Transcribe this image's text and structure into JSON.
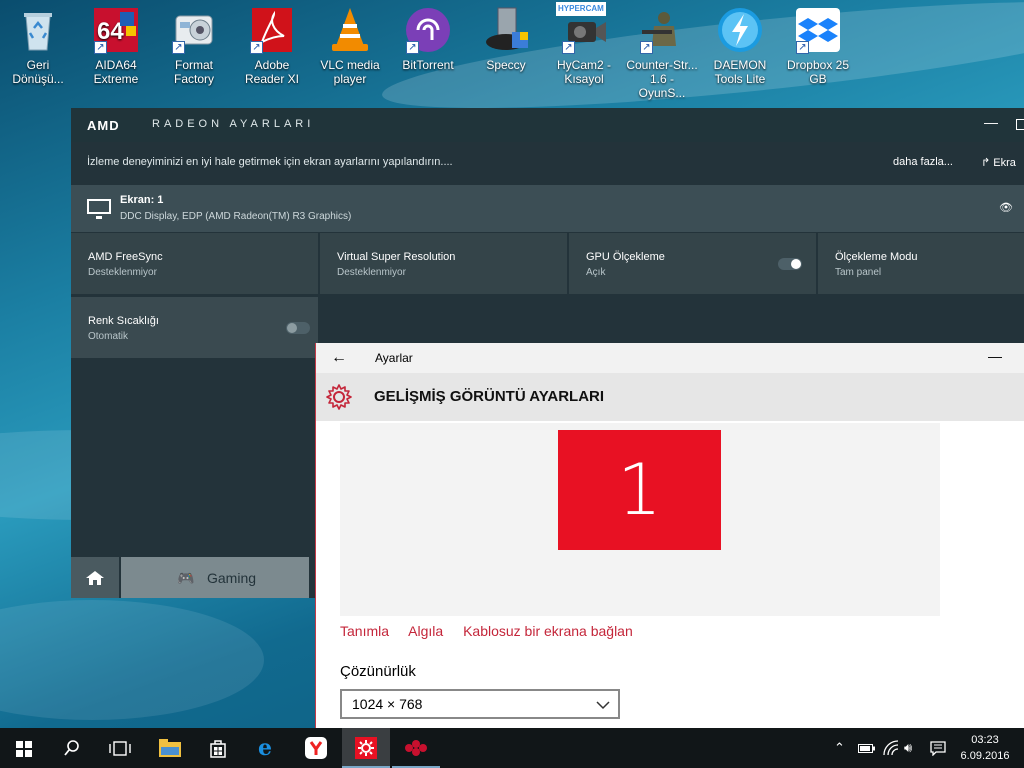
{
  "desktop": {
    "icons": [
      {
        "label": "Geri Dönüşü...",
        "icon": "recycle-bin-icon"
      },
      {
        "label": "AIDA64 Extreme",
        "icon": "aida64-icon"
      },
      {
        "label": "Format Factory",
        "icon": "format-factory-icon"
      },
      {
        "label": "Adobe Reader XI",
        "icon": "adobe-reader-icon"
      },
      {
        "label": "VLC media player",
        "icon": "vlc-icon"
      },
      {
        "label": "BitTorrent",
        "icon": "bittorrent-icon"
      },
      {
        "label": "Speccy",
        "icon": "speccy-icon"
      },
      {
        "label": "HyCam2 - Kısayol",
        "icon": "hycam-icon",
        "badge": "HYPERCAM"
      },
      {
        "label": "Counter-Str... 1.6 - OyunS...",
        "icon": "counter-strike-icon"
      },
      {
        "label": "DAEMON Tools Lite",
        "icon": "daemon-tools-icon"
      },
      {
        "label": "Dropbox 25 GB",
        "icon": "dropbox-icon"
      }
    ],
    "aida_text": "64"
  },
  "amd": {
    "logo": "AMD",
    "title": "RADEON AYARLARI",
    "description": "İzleme deneyiminizi en iyi hale getirmek için ekran ayarlarını yapılandırın....",
    "more_link": "daha fazla...",
    "external_link": "Ekra",
    "display": {
      "name": "Ekran: 1",
      "detail": "DDC Display, EDP (AMD Radeon(TM) R3 Graphics)"
    },
    "tiles": [
      {
        "title": "AMD FreeSync",
        "status": "Desteklenmiyor"
      },
      {
        "title": "Virtual Super Resolution",
        "status": "Desteklenmiyor"
      },
      {
        "title": "GPU Ölçekleme",
        "status": "Açık",
        "toggle": "on"
      },
      {
        "title": "Ölçekleme Modu",
        "status": "Tam panel"
      },
      {
        "title": "Renk Sıcaklığı",
        "status": "Otomatik",
        "toggle": "off"
      }
    ],
    "bottom": {
      "gaming_label": "Gaming"
    }
  },
  "settings": {
    "app_title": "Ayarlar",
    "header": "GELİŞMİŞ GÖRÜNTÜ AYARLARI",
    "monitor_number": "1",
    "links": [
      "Tanımla",
      "Algıla",
      "Kablosuz bir ekrana bağlan"
    ],
    "resolution_label": "Çözünürlük",
    "resolution_value": "1024 × 768"
  },
  "taskbar": {
    "clock_time": "03:23",
    "clock_date": "6.09.2016"
  },
  "colors": {
    "accent_red": "#e81123",
    "link_red": "#c4263a",
    "amd_bg": "#23333a"
  }
}
